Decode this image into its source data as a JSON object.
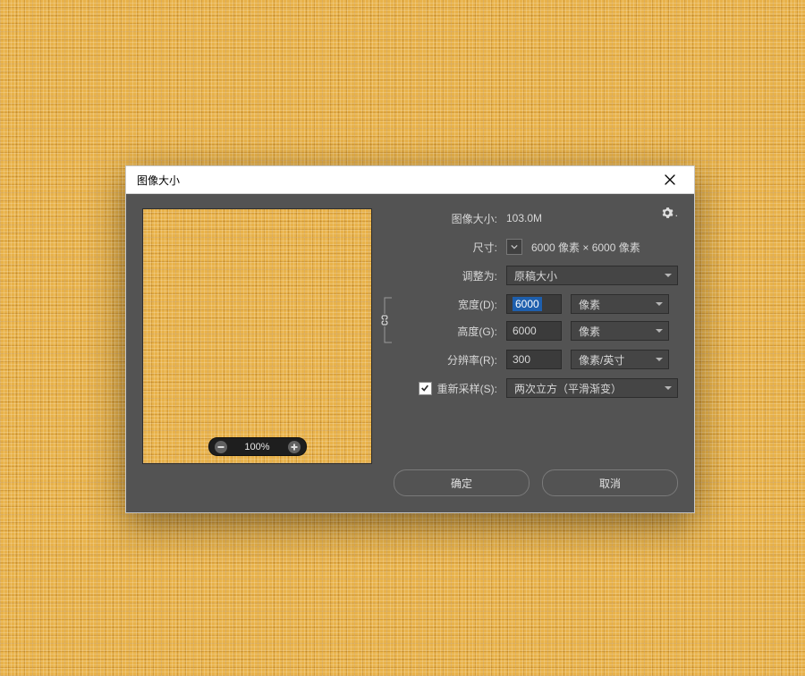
{
  "dialog": {
    "title": "图像大小",
    "close_tooltip": "关闭"
  },
  "preview": {
    "zoom": "100%"
  },
  "summary": {
    "image_size_label": "图像大小:",
    "image_size_value": "103.0M",
    "dimensions_label": "尺寸:",
    "dimensions_value": "6000 像素 × 6000 像素",
    "gear_name": "gear-icon"
  },
  "fit": {
    "label": "调整为:",
    "value": "原稿大小"
  },
  "width": {
    "label": "宽度(D):",
    "value": "6000",
    "unit": "像素"
  },
  "height": {
    "label": "高度(G):",
    "value": "6000",
    "unit": "像素"
  },
  "resolution": {
    "label": "分辨率(R):",
    "value": "300",
    "unit": "像素/英寸"
  },
  "resample": {
    "checked": true,
    "label": "重新采样(S):",
    "method": "两次立方（平滑渐变）"
  },
  "actions": {
    "ok": "确定",
    "cancel": "取消"
  }
}
